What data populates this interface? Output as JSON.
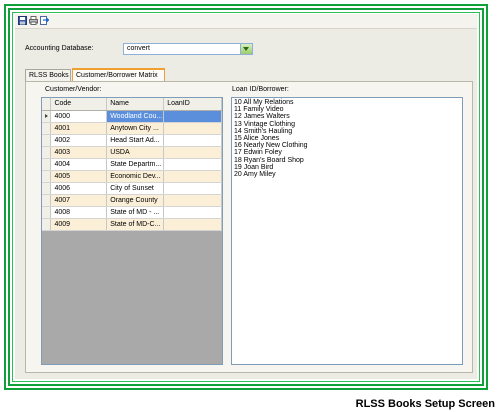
{
  "toolbar": {
    "icons": [
      "save-icon",
      "print-icon",
      "export-icon"
    ]
  },
  "form": {
    "accounting_label": "Accounting Database:",
    "accounting_value": "convert"
  },
  "tabs": [
    {
      "label": "RLSS Books",
      "active": false
    },
    {
      "label": "Customer/Borrower Matrix",
      "active": true
    }
  ],
  "customer": {
    "label": "Customer/Vendor:",
    "columns": [
      "Code",
      "Name",
      "LoanID"
    ],
    "rows": [
      {
        "code": "4000",
        "name": "Woodland Cou...",
        "loan": ""
      },
      {
        "code": "4001",
        "name": "Anytown City ...",
        "loan": ""
      },
      {
        "code": "4002",
        "name": "Head Start Ad...",
        "loan": ""
      },
      {
        "code": "4003",
        "name": "USDA",
        "loan": ""
      },
      {
        "code": "4004",
        "name": "State Departm...",
        "loan": ""
      },
      {
        "code": "4005",
        "name": "Economic Dev...",
        "loan": ""
      },
      {
        "code": "4006",
        "name": "City of Sunset",
        "loan": ""
      },
      {
        "code": "4007",
        "name": "Orange County",
        "loan": ""
      },
      {
        "code": "4008",
        "name": "State of MD - ...",
        "loan": ""
      },
      {
        "code": "4009",
        "name": "State of MD-C...",
        "loan": ""
      }
    ]
  },
  "loan": {
    "label": "Loan ID/Borrower:",
    "items": [
      "10 All My Relations",
      "11 Family Video",
      "12 James Walters",
      "13 Vintage Clothing",
      "14 Smith's Hauling",
      "15 Alice Jones",
      "16 Nearly New Clothing",
      "17 Edwin Foley",
      "18 Ryan's Board Shop",
      "19 Joan Bird",
      "20 Amy Miley"
    ]
  },
  "caption": "RLSS Books Setup Screen",
  "colors": {
    "frame": "#10a03a",
    "selection": "#5b8fdc",
    "alt_row": "#fcefd8",
    "active_tab": "#f0a030"
  }
}
